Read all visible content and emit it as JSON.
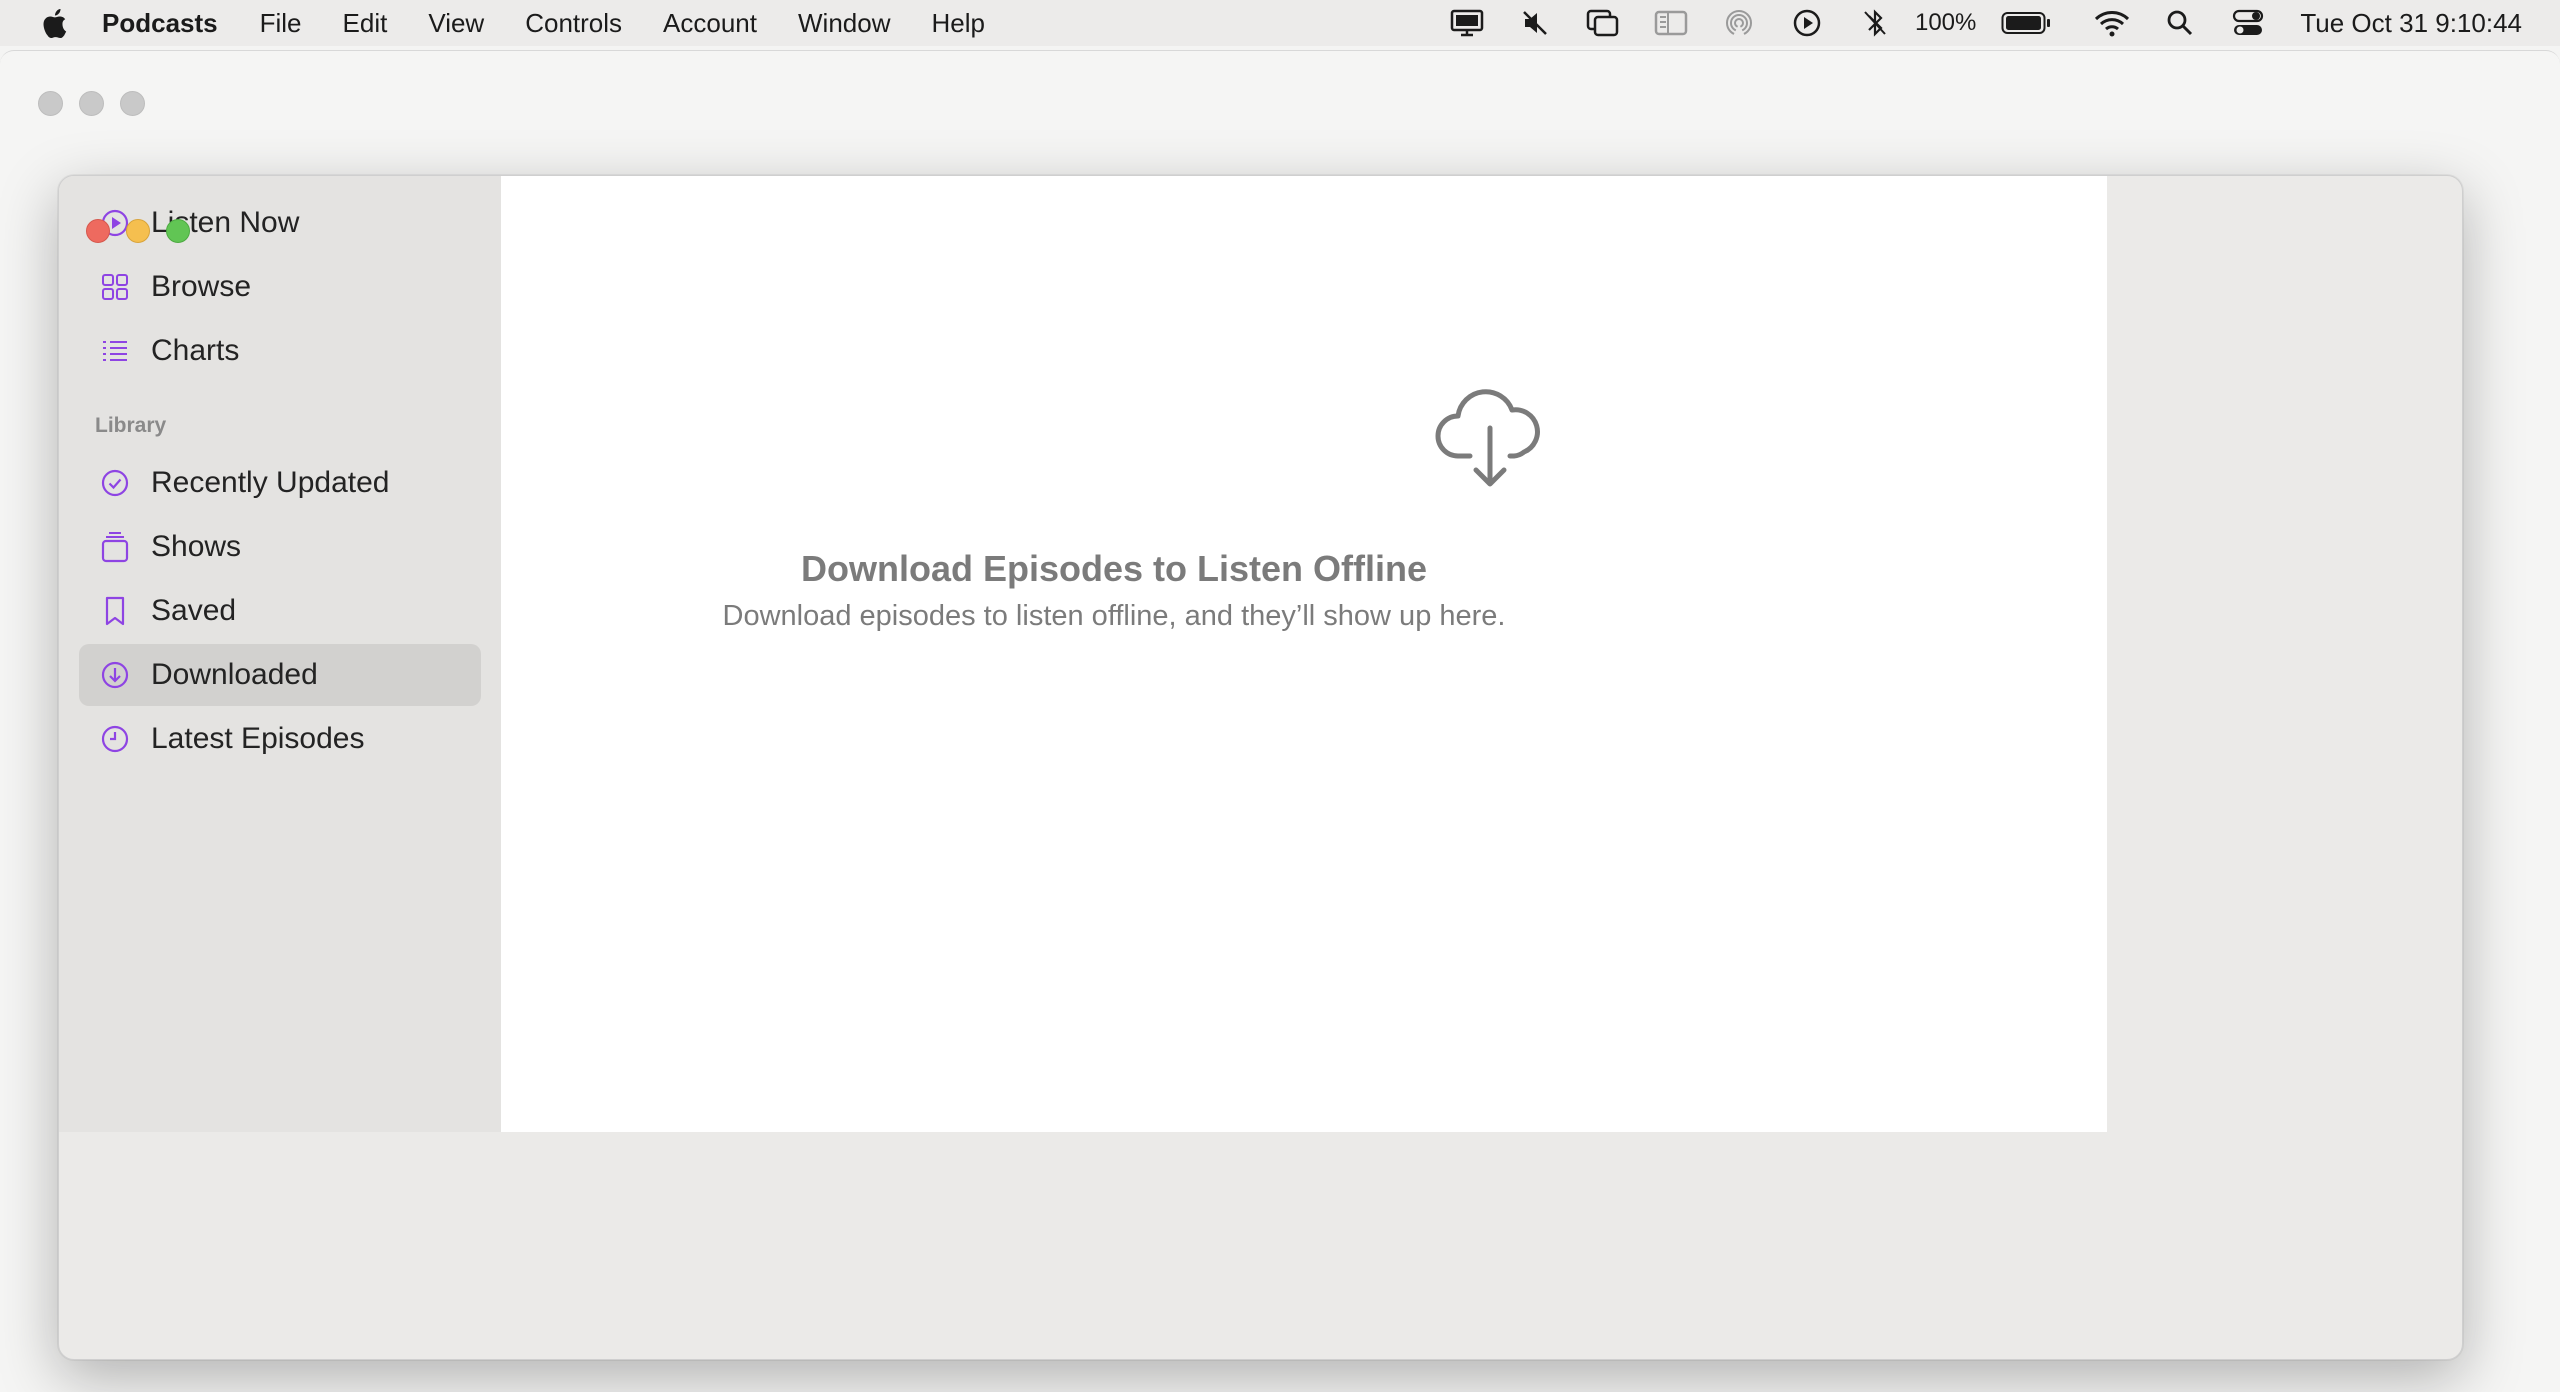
{
  "menubar": {
    "app_name": "Podcasts",
    "items": [
      "File",
      "Edit",
      "View",
      "Controls",
      "Account",
      "Window",
      "Help"
    ],
    "battery_percent": "100%",
    "clock": "Tue Oct 31  9:10:44"
  },
  "sidebar": {
    "top_items": [
      {
        "label": "Listen Now",
        "icon": "play-circle-icon"
      },
      {
        "label": "Browse",
        "icon": "grid-icon"
      },
      {
        "label": "Charts",
        "icon": "list-icon"
      }
    ],
    "library_label": "Library",
    "library_items": [
      {
        "label": "Recently Updated",
        "icon": "check-circle-icon"
      },
      {
        "label": "Shows",
        "icon": "stack-icon"
      },
      {
        "label": "Saved",
        "icon": "bookmark-icon"
      },
      {
        "label": "Downloaded",
        "icon": "download-circle-icon",
        "selected": true
      },
      {
        "label": "Latest Episodes",
        "icon": "clock-icon"
      }
    ]
  },
  "content": {
    "empty_title": "Download Episodes to Listen Offline",
    "empty_subtitle": "Download episodes to listen offline, and they’ll show up here."
  },
  "colors": {
    "accent": "#8e44e3",
    "selected_bg": "#d2d1cf",
    "muted_text": "#7b7b7b"
  }
}
